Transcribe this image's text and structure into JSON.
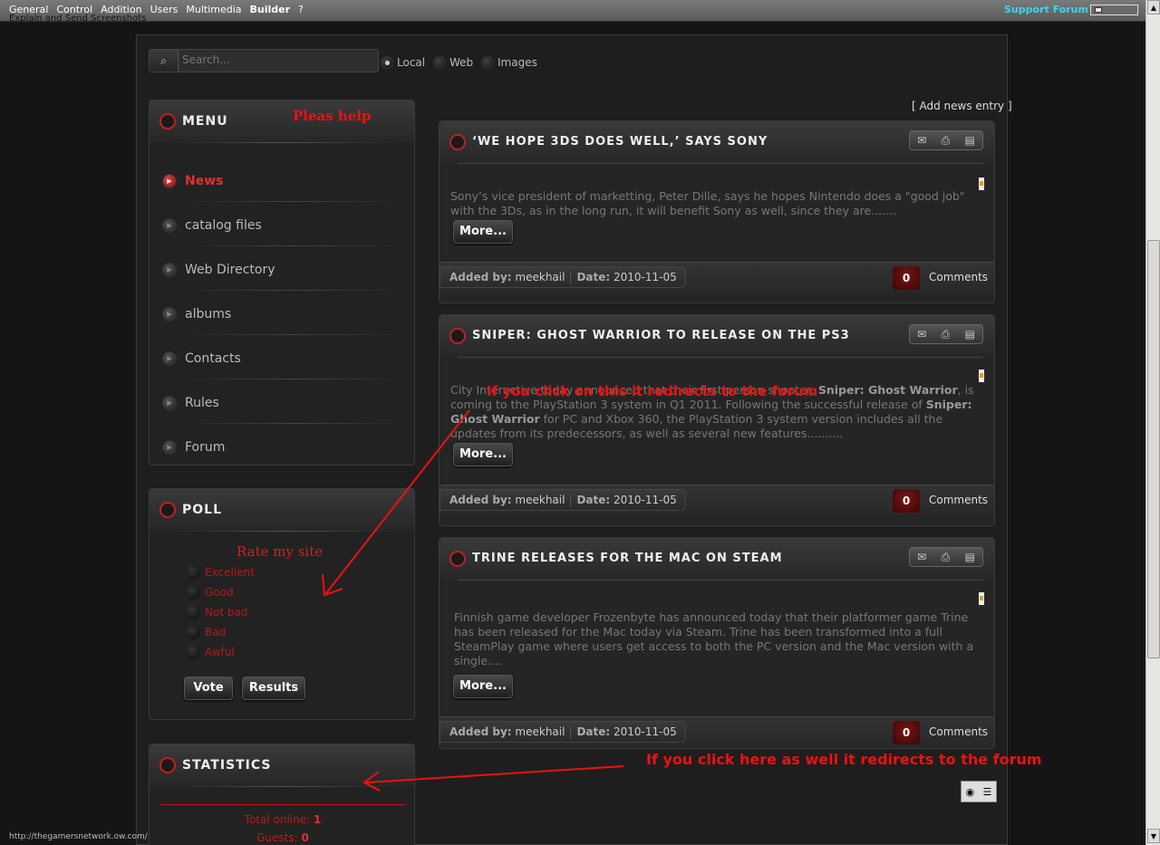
{
  "topbar": {
    "menu": [
      "General",
      "Control",
      "Addition",
      "Users",
      "Multimedia",
      "Builder",
      "?"
    ],
    "subtitle": "Explain and Send Screenshots",
    "support": "Support Forum"
  },
  "search": {
    "placeholder": "Search...",
    "options": [
      "Local",
      "Web",
      "Images"
    ]
  },
  "menu_box": {
    "title": "MENU",
    "annotation": "Pleas help",
    "items": [
      "News",
      "catalog files",
      "Web Directory",
      "albums",
      "Contacts",
      "Rules",
      "Forum"
    ]
  },
  "poll": {
    "title": "POLL",
    "question": "Rate my site",
    "options": [
      "Excellent",
      "Good",
      "Not bad",
      "Bad",
      "Awful"
    ],
    "vote": "Vote",
    "results": "Results"
  },
  "stats": {
    "title": "STATISTICS",
    "online_label": "Total online:",
    "online_value": "1",
    "guests_label": "Guests:",
    "guests_value": "0"
  },
  "news": {
    "add_link": "[ Add news entry ]",
    "more": "More...",
    "added_by_label": "Added by:",
    "date_label": "Date:",
    "comments_label": "Comments",
    "entries": [
      {
        "title": "‘WE HOPE 3DS DOES WELL,’ SAYS SONY",
        "text": "Sony’s vice president of marketting, Peter Dille, says he hopes Nintendo does a \"good job\" with the 3Ds, as in the long run, it will benefit Sony as well, since they are.......",
        "author": "meekhail",
        "date": "2010-11-05",
        "comments": "0"
      },
      {
        "title": "SNIPER: GHOST WARRIOR TO RELEASE ON THE PS3",
        "text_a": "City Interactive today announced that their first person shooter, ",
        "text_b": "Sniper: Ghost Warrior",
        "text_c": ", is coming to the PlayStation 3 system in Q1 2011.  Following the successful release of ",
        "text_d": "Sniper: Ghost Warrior",
        "text_e": " for PC and Xbox 360, the PlayStation 3 system version includes all the updates from its predecessors, as well as several new features..........",
        "author": "meekhail",
        "date": "2010-11-05",
        "comments": "0"
      },
      {
        "title": "TRINE RELEASES FOR THE MAC ON STEAM",
        "text": "Finnish game developer Frozenbyte has announced today that their  platformer game Trine has been released for the Mac today via Steam. Trine has been transformed into a full SteamPlay game where users get access to both the PC version and the Mac version with a single....",
        "author": "meekhail",
        "date": "2010-11-05",
        "comments": "0"
      }
    ]
  },
  "annotations": {
    "note1": "If you click on this it redirects to the forum",
    "note2": "If you click here as well it redirects to the forum"
  },
  "status_url": "http://thegamersnetwork.ow.com/",
  "colors": {
    "accent": "#e02020",
    "support": "#39d6f0"
  }
}
